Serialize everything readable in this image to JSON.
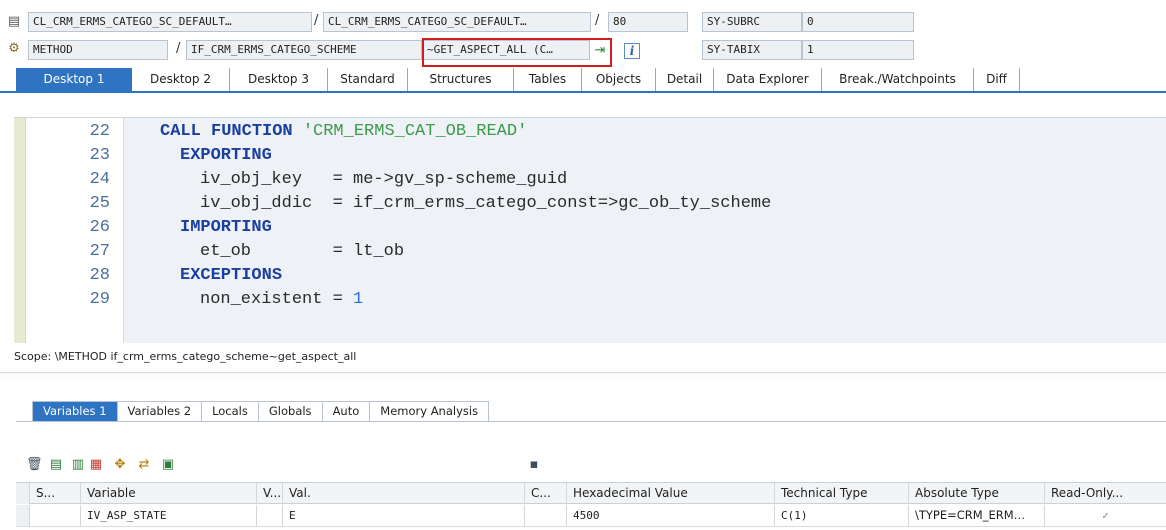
{
  "header": {
    "program1": "CL_CRM_ERMS_CATEGO_SC_DEFAULT…",
    "program2": "CL_CRM_ERMS_CATEGO_SC_DEFAULT…",
    "line_no": "80",
    "kind": "METHOD",
    "method_interface": "IF_CRM_ERMS_CATEGO_SCHEME",
    "method_name": "~GET_ASPECT_ALL (C…",
    "info_label": "i",
    "sysvar1_name": "SY-SUBRC",
    "sysvar1_value": "0",
    "sysvar2_name": "SY-TABIX",
    "sysvar2_value": "1"
  },
  "desktop_tabs": [
    "Desktop 1",
    "Desktop 2",
    "Desktop 3",
    "Standard",
    "Structures",
    "Tables",
    "Objects",
    "Detail",
    "Data Explorer",
    "Break./Watchpoints",
    "Diff"
  ],
  "code": {
    "lines": [
      {
        "no": "22",
        "indent": "  ",
        "parts": [
          {
            "t": "CALL FUNCTION ",
            "c": "kw"
          },
          {
            "t": "'CRM_ERMS_CAT_OB_READ'",
            "c": "str"
          }
        ]
      },
      {
        "no": "23",
        "indent": "    ",
        "parts": [
          {
            "t": "EXPORTING",
            "c": "kw"
          }
        ]
      },
      {
        "no": "24",
        "indent": "      ",
        "parts": [
          {
            "t": "iv_obj_key   = me->gv_sp-scheme_guid",
            "c": "plain"
          }
        ]
      },
      {
        "no": "25",
        "indent": "      ",
        "parts": [
          {
            "t": "iv_obj_ddic  = if_crm_erms_catego_const=>gc_ob_ty_scheme",
            "c": "plain"
          }
        ]
      },
      {
        "no": "26",
        "indent": "    ",
        "parts": [
          {
            "t": "IMPORTING",
            "c": "kw"
          }
        ]
      },
      {
        "no": "27",
        "indent": "      ",
        "parts": [
          {
            "t": "et_ob        = lt_ob",
            "c": "plain"
          }
        ]
      },
      {
        "no": "28",
        "indent": "    ",
        "parts": [
          {
            "t": "EXCEPTIONS",
            "c": "kw"
          }
        ]
      },
      {
        "no": "29",
        "indent": "      ",
        "parts": [
          {
            "t": "non_existent = ",
            "c": "plain"
          },
          {
            "t": "1",
            "c": "num"
          }
        ]
      }
    ]
  },
  "scope": "Scope: \\METHOD if_crm_erms_catego_scheme~get_aspect_all",
  "variable_tabs": [
    "Variables 1",
    "Variables 2",
    "Locals",
    "Globals",
    "Auto",
    "Memory Analysis"
  ],
  "table": {
    "columns": [
      "S...",
      "Variable",
      "V...",
      "Val.",
      "C...",
      "Hexadecimal Value",
      "Technical Type",
      "Absolute Type",
      "Read-Only..."
    ],
    "rows": [
      {
        "s": "",
        "variable": "IV_ASP_STATE",
        "v": "",
        "val": "E",
        "c": "",
        "hex": "4500",
        "tech": "C(1)",
        "abs": "\\TYPE=CRM_ERM…",
        "readonly": "✓"
      }
    ]
  }
}
